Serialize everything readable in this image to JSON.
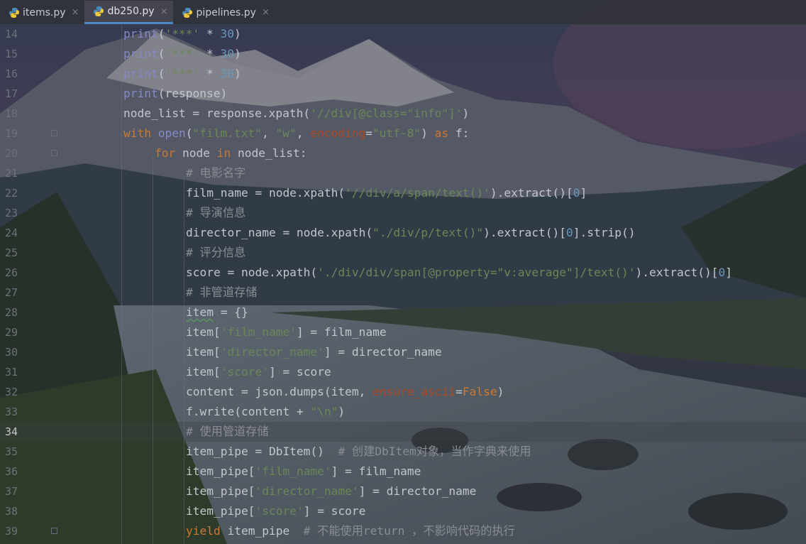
{
  "tabs": [
    {
      "name": "items.py",
      "active": false
    },
    {
      "name": "db250.py",
      "active": true
    },
    {
      "name": "pipelines.py",
      "active": false
    }
  ],
  "close_glyph": "×",
  "current_line": 34,
  "lines": [
    {
      "n": "14",
      "indent": 2,
      "tokens": [
        [
          "bi",
          "print"
        ],
        [
          "t",
          "("
        ],
        [
          "str",
          "'***'"
        ],
        [
          "t",
          " * "
        ],
        [
          "num",
          "30"
        ],
        [
          "t",
          ")"
        ]
      ]
    },
    {
      "n": "15",
      "indent": 2,
      "tokens": [
        [
          "bi",
          "print"
        ],
        [
          "t",
          "("
        ],
        [
          "str",
          "'***'"
        ],
        [
          "t",
          " * "
        ],
        [
          "num",
          "30"
        ],
        [
          "t",
          ")"
        ]
      ]
    },
    {
      "n": "16",
      "indent": 2,
      "tokens": [
        [
          "bi",
          "print"
        ],
        [
          "t",
          "("
        ],
        [
          "str",
          "'***'"
        ],
        [
          "t",
          " * "
        ],
        [
          "num",
          "30"
        ],
        [
          "t",
          ")"
        ]
      ]
    },
    {
      "n": "17",
      "indent": 2,
      "tokens": [
        [
          "bi",
          "print"
        ],
        [
          "t",
          "(response)"
        ]
      ]
    },
    {
      "n": "18",
      "indent": 2,
      "tokens": [
        [
          "t",
          "node_list = response.xpath("
        ],
        [
          "str",
          "'//div[@class=\"info\"]'"
        ],
        [
          "t",
          ")"
        ]
      ]
    },
    {
      "n": "19",
      "indent": 2,
      "fold": true,
      "tokens": [
        [
          "kw",
          "with "
        ],
        [
          "bi",
          "open"
        ],
        [
          "t",
          "("
        ],
        [
          "str",
          "\"film.txt\""
        ],
        [
          "t",
          ", "
        ],
        [
          "str",
          "\"w\""
        ],
        [
          "t",
          ", "
        ],
        [
          "pm",
          "encoding"
        ],
        [
          "t",
          "="
        ],
        [
          "str",
          "\"utf-8\""
        ],
        [
          "t",
          ") "
        ],
        [
          "kw",
          "as"
        ],
        [
          "t",
          " f:"
        ]
      ]
    },
    {
      "n": "20",
      "indent": 3,
      "fold": true,
      "tokens": [
        [
          "kw",
          "for"
        ],
        [
          "t",
          " node "
        ],
        [
          "kw",
          "in"
        ],
        [
          "t",
          " node_list:"
        ]
      ]
    },
    {
      "n": "21",
      "indent": 4,
      "tokens": [
        [
          "cm",
          "# 电影名字"
        ]
      ]
    },
    {
      "n": "22",
      "indent": 4,
      "tokens": [
        [
          "t",
          "film_name = node.xpath("
        ],
        [
          "str",
          "'//div/a/span/text()'"
        ],
        [
          "t",
          ").extract()["
        ],
        [
          "num",
          "0"
        ],
        [
          "t",
          "]"
        ]
      ]
    },
    {
      "n": "23",
      "indent": 4,
      "tokens": [
        [
          "cm",
          "# 导演信息"
        ]
      ]
    },
    {
      "n": "24",
      "indent": 4,
      "tokens": [
        [
          "t",
          "director_name = node.xpath("
        ],
        [
          "str",
          "\"./div/p/text()\""
        ],
        [
          "t",
          ").extract()["
        ],
        [
          "num",
          "0"
        ],
        [
          "t",
          "].strip()"
        ]
      ]
    },
    {
      "n": "25",
      "indent": 4,
      "tokens": [
        [
          "cm",
          "# 评分信息"
        ]
      ]
    },
    {
      "n": "26",
      "indent": 4,
      "tokens": [
        [
          "t",
          "score = node.xpath("
        ],
        [
          "str",
          "'./div/div/span[@property=\"v:average\"]/text()'"
        ],
        [
          "t",
          ").extract()["
        ],
        [
          "num",
          "0"
        ],
        [
          "t",
          "]"
        ]
      ]
    },
    {
      "n": "27",
      "indent": 4,
      "tokens": [
        [
          "cm",
          "# 非管道存储"
        ]
      ]
    },
    {
      "n": "28",
      "indent": 4,
      "tokens": [
        [
          "sq",
          "item"
        ],
        [
          "t",
          " = {}"
        ]
      ]
    },
    {
      "n": "29",
      "indent": 4,
      "tokens": [
        [
          "t",
          "item["
        ],
        [
          "str",
          "'film_name'"
        ],
        [
          "t",
          "] = film_name"
        ]
      ]
    },
    {
      "n": "30",
      "indent": 4,
      "tokens": [
        [
          "t",
          "item["
        ],
        [
          "str",
          "'director_name'"
        ],
        [
          "t",
          "] = director_name"
        ]
      ]
    },
    {
      "n": "31",
      "indent": 4,
      "tokens": [
        [
          "t",
          "item["
        ],
        [
          "str",
          "'score'"
        ],
        [
          "t",
          "] = score"
        ]
      ]
    },
    {
      "n": "32",
      "indent": 4,
      "tokens": [
        [
          "t",
          "content = json.dumps(item, "
        ],
        [
          "pm",
          "ensure_ascii"
        ],
        [
          "t",
          "="
        ],
        [
          "kw",
          "False"
        ],
        [
          "t",
          ")"
        ]
      ]
    },
    {
      "n": "33",
      "indent": 4,
      "tokens": [
        [
          "t",
          "f.write(content + "
        ],
        [
          "str",
          "\"\\n\""
        ],
        [
          "t",
          ")"
        ]
      ]
    },
    {
      "n": "34",
      "indent": 4,
      "tokens": [
        [
          "cm",
          "# 使用管道存储"
        ]
      ]
    },
    {
      "n": "35",
      "indent": 4,
      "tokens": [
        [
          "t",
          "item_pipe = DbItem()  "
        ],
        [
          "cm",
          "# 创建DbItem对象，当作字典来使用"
        ]
      ]
    },
    {
      "n": "36",
      "indent": 4,
      "tokens": [
        [
          "t",
          "item_pipe["
        ],
        [
          "str",
          "'film_name'"
        ],
        [
          "t",
          "] = film_name"
        ]
      ]
    },
    {
      "n": "37",
      "indent": 4,
      "tokens": [
        [
          "t",
          "item_pipe["
        ],
        [
          "str",
          "'director_name'"
        ],
        [
          "t",
          "] = director_name"
        ]
      ]
    },
    {
      "n": "38",
      "indent": 4,
      "tokens": [
        [
          "t",
          "item_pipe["
        ],
        [
          "str",
          "'score'"
        ],
        [
          "t",
          "] = score"
        ]
      ]
    },
    {
      "n": "39",
      "indent": 4,
      "fold": true,
      "tokens": [
        [
          "kw",
          "yield"
        ],
        [
          "t",
          " item_pipe  "
        ],
        [
          "cm",
          "# 不能使用return ，不影响代码的执行"
        ]
      ]
    }
  ]
}
